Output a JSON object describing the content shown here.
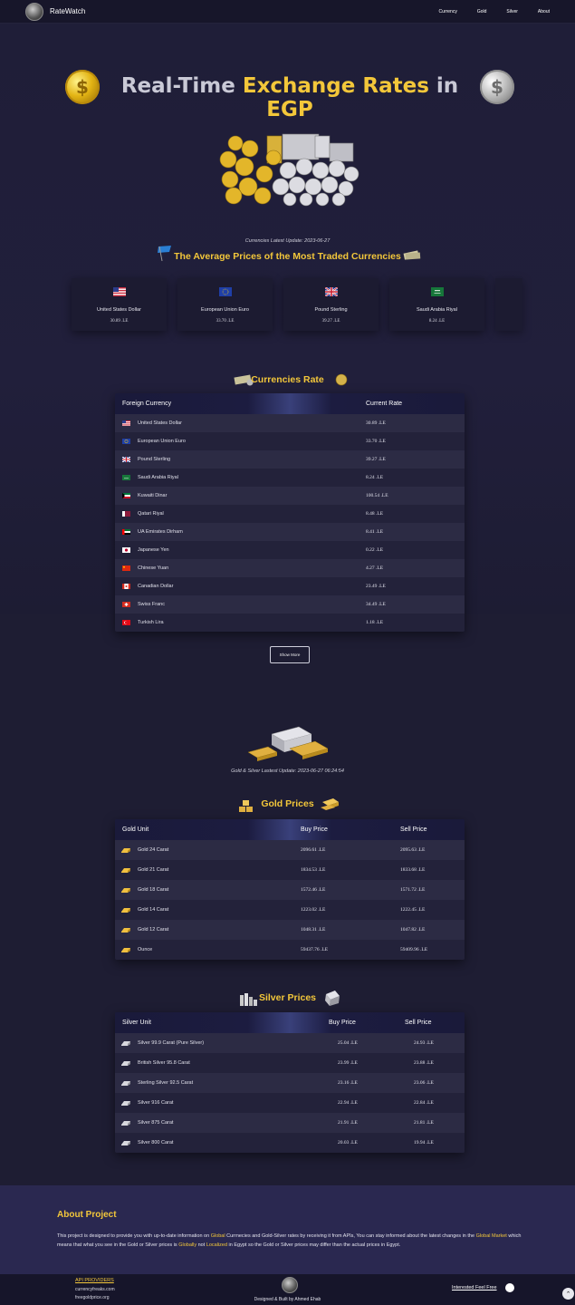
{
  "nav": {
    "brand": "RateWatch",
    "links": [
      "Currency",
      "Gold",
      "Silver",
      "About"
    ]
  },
  "hero": {
    "title_a": "Real-Time ",
    "title_b": "Exchange Rates",
    "title_c": " in",
    "title_d": "EGP"
  },
  "currencies_update": "Currencies Latest Update: 2023-06-27",
  "avg_title": "The Average Prices of the Most Traded Currencies",
  "cards": [
    {
      "name": "United States Dollar",
      "value": "30.89 .LE",
      "flag": "us-flag-icon"
    },
    {
      "name": "European Union Euro",
      "value": "33.70 .LE",
      "flag": "eu-flag-icon"
    },
    {
      "name": "Pound Sterling",
      "value": "39.27 .LE",
      "flag": "uk-flag-icon"
    },
    {
      "name": "Saudi Arabia Riyal",
      "value": "8.24 .LE",
      "flag": "sa-flag-icon"
    }
  ],
  "rates_title": "Currencies Rate",
  "rates_table": {
    "headers": [
      "Foreign Currency",
      "Current Rate"
    ],
    "rows": [
      {
        "name": "United States Dollar",
        "rate": "30.89 .LE",
        "flag": "us-flag-icon"
      },
      {
        "name": "European Union Euro",
        "rate": "33.70 .LE",
        "flag": "eu-flag-icon"
      },
      {
        "name": "Pound Sterling",
        "rate": "39.27 .LE",
        "flag": "uk-flag-icon"
      },
      {
        "name": "Saudi Arabia Riyal",
        "rate": "8.24 .LE",
        "flag": "sa-flag-icon"
      },
      {
        "name": "Kuwaiti Dinar",
        "rate": "100.54 .LE",
        "flag": "kw-flag-icon"
      },
      {
        "name": "Qatari Riyal",
        "rate": "8.48 .LE",
        "flag": "qa-flag-icon"
      },
      {
        "name": "UA Emirates Dirham",
        "rate": "8.41 .LE",
        "flag": "ae-flag-icon"
      },
      {
        "name": "Japanese Yen",
        "rate": "0.22 .LE",
        "flag": "jp-flag-icon"
      },
      {
        "name": "Chinese Yuan",
        "rate": "4.27 .LE",
        "flag": "cn-flag-icon"
      },
      {
        "name": "Canadian Dollar",
        "rate": "23.49 .LE",
        "flag": "ca-flag-icon"
      },
      {
        "name": "Swiss Franc",
        "rate": "34.49 .LE",
        "flag": "ch-flag-icon"
      },
      {
        "name": "Turkish Lira",
        "rate": "1.18 .LE",
        "flag": "tr-flag-icon"
      }
    ]
  },
  "show_more": "Show More",
  "metals_update": "Gold & Silver Lastest Update: 2023-06-27 06:24:54",
  "gold_title": "Gold Prices",
  "gold_table": {
    "headers": [
      "Gold Unit",
      "Buy Price",
      "Sell Price"
    ],
    "rows": [
      {
        "name": "Gold 24 Carat",
        "buy": "2096.61 .LE",
        "sell": "2095.63 .LE"
      },
      {
        "name": "Gold 21 Carat",
        "buy": "1834.53 .LE",
        "sell": "1833.68 .LE"
      },
      {
        "name": "Gold 18 Carat",
        "buy": "1572.46 .LE",
        "sell": "1571.72 .LE"
      },
      {
        "name": "Gold 14 Carat",
        "buy": "1223.02 .LE",
        "sell": "1222.45 .LE"
      },
      {
        "name": "Gold 12 Carat",
        "buy": "1048.31 .LE",
        "sell": "1047.82 .LE"
      },
      {
        "name": "Ounce",
        "buy": "59437.76 .LE",
        "sell": "59409.96 .LE"
      }
    ]
  },
  "silver_title": "Silver Prices",
  "silver_table": {
    "headers": [
      "Silver Unit",
      "Buy Price",
      "Sell Price"
    ],
    "rows": [
      {
        "name": "Silver 99.9 Carat (Pure Silver)",
        "buy": "25.04 .LE",
        "sell": "24.93 .LE"
      },
      {
        "name": "British Silver 95.8 Carat",
        "buy": "23.99 .LE",
        "sell": "23.88 .LE"
      },
      {
        "name": "Sterling Silver 92.5 Carat",
        "buy": "23.16 .LE",
        "sell": "23.06 .LE"
      },
      {
        "name": "Silver 916 Carat",
        "buy": "22.94 .LE",
        "sell": "22.84 .LE"
      },
      {
        "name": "Silver 875 Carat",
        "buy": "21.91 .LE",
        "sell": "21.81 .LE"
      },
      {
        "name": "Silver 800 Carat",
        "buy": "20.03 .LE",
        "sell": "19.94 .LE"
      }
    ]
  },
  "about": {
    "title": "About Project",
    "p1": "This project is designed to provide you with up-to-date information on ",
    "w1": "Global",
    "p2": " Currnecies and Gold-Silver rates by receiving it from APIs, You can stay informed about the latest changes in the ",
    "w2": "Global Market",
    "p3": " which means that what you see in the Gold or Silver prices is ",
    "w3": "Globally",
    "p4": " not ",
    "w4": "Localized",
    "p5": " in Egypt so the Gold or Silver prices may differ than the actual prices in Egypt."
  },
  "footer": {
    "api_title": "API PROVIDERS",
    "sources": [
      "currencyfreaks.com",
      "freegoldprice.org"
    ],
    "credit": "Designed & Built by Ahmed Ehab",
    "interested": "Interested Feel Free"
  },
  "colors": {
    "accent": "#f3c73a",
    "background": "#1e1d33"
  }
}
